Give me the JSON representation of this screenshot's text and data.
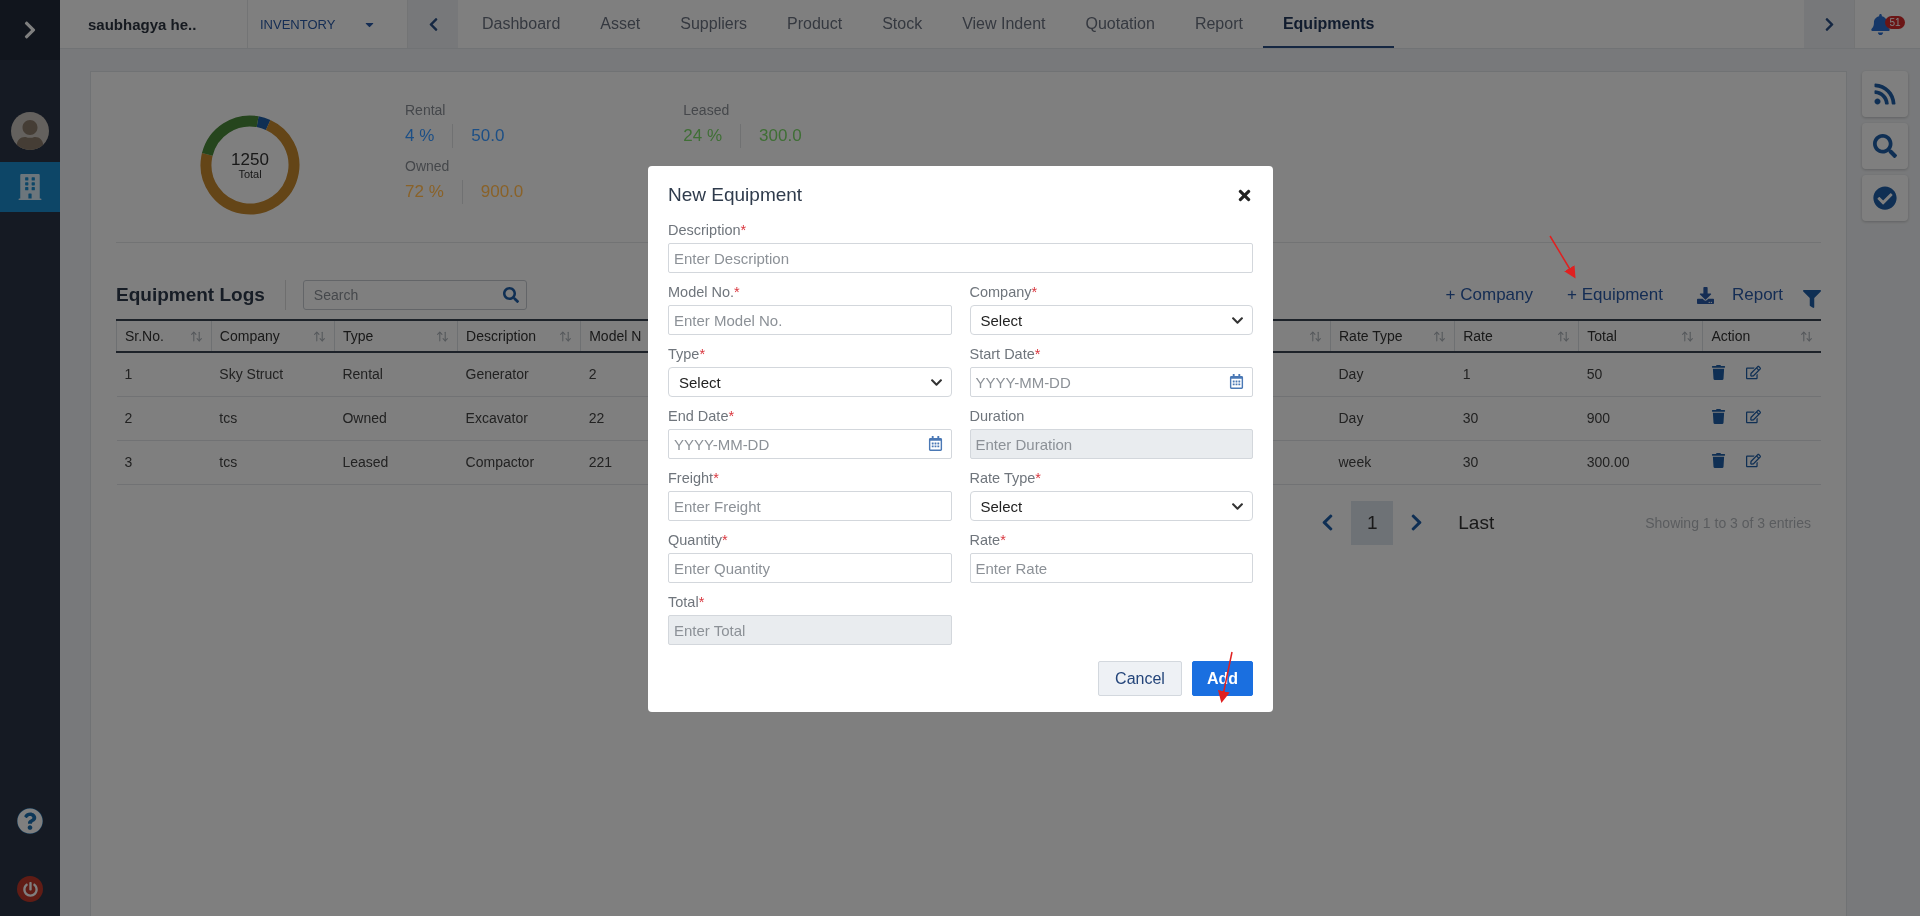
{
  "top_bar": {
    "brand": "saubhagya he..",
    "module": "INVENTORY",
    "notifications": "51",
    "tabs": [
      {
        "label": "Dashboard",
        "selected": false
      },
      {
        "label": "Asset",
        "selected": false
      },
      {
        "label": "Suppliers",
        "selected": false
      },
      {
        "label": "Product",
        "selected": false
      },
      {
        "label": "Stock",
        "selected": false
      },
      {
        "label": "View Indent",
        "selected": false
      },
      {
        "label": "Quotation",
        "selected": false
      },
      {
        "label": "Report",
        "selected": false
      },
      {
        "label": "Equipments",
        "selected": true
      }
    ]
  },
  "sidebar": {
    "items": [
      {
        "kind": "avatar",
        "selected": false
      },
      {
        "kind": "building",
        "selected": true
      }
    ]
  },
  "summary": {
    "total": "1250",
    "total_label": "Total",
    "columns": [
      [
        {
          "label": "Rental",
          "percent": "4 %",
          "amount": "50.0",
          "color": "#1c4f86"
        },
        {
          "label": "Owned",
          "percent": "72 %",
          "amount": "900.0",
          "color": "#8a6228"
        }
      ],
      [
        {
          "label": "Leased",
          "percent": "24 %",
          "amount": "300.0",
          "color": "#3f6f35"
        }
      ]
    ]
  },
  "logs": {
    "title": "Equipment Logs",
    "search": {
      "placeholder": "Search"
    },
    "actions": [
      {
        "kind": "link",
        "label": "+ Company"
      },
      {
        "kind": "link",
        "label": "+ Equipment"
      },
      {
        "kind": "download",
        "label": "Report"
      },
      {
        "kind": "filter"
      }
    ],
    "table": {
      "columns": [
        "Sr.No.",
        "Company",
        "Type",
        "Description",
        "Model N",
        "Rate Type",
        "Rate",
        "Total",
        "Action"
      ],
      "rows": [
        [
          "1",
          "Sky Struct",
          "Rental",
          "Generator",
          "2",
          "Day",
          "1",
          "50"
        ],
        [
          "2",
          "tcs",
          "Owned",
          "Excavator",
          "22",
          "Day",
          "30",
          "900"
        ],
        [
          "3",
          "tcs",
          "Leased",
          "Compactor",
          "221",
          "week",
          "30",
          "300.00"
        ]
      ]
    },
    "pagination": {
      "pages": [
        {
          "label": "1",
          "selected": true
        }
      ],
      "last": "Last",
      "info": "Showing 1 to 3 of 3 entries"
    }
  },
  "modal": {
    "title": "New Equipment",
    "wide_field": {
      "label": "Description",
      "required_mark": "*",
      "kind": "text",
      "placeholder": "Enter Description"
    },
    "fields": [
      {
        "label": "Model No.",
        "required_mark": "*",
        "kind": "text",
        "placeholder": "Enter Model No."
      },
      {
        "label": "Company",
        "required_mark": "*",
        "kind": "select",
        "value": "Select"
      },
      {
        "label": "Type",
        "required_mark": "*",
        "kind": "select",
        "value": "Select"
      },
      {
        "label": "Start Date",
        "required_mark": "*",
        "kind": "date",
        "placeholder": "YYYY-MM-DD"
      },
      {
        "label": "End Date",
        "required_mark": "*",
        "kind": "date",
        "placeholder": "YYYY-MM-DD"
      },
      {
        "label": "Duration",
        "kind": "readonly",
        "placeholder": "Enter Duration"
      },
      {
        "label": "Freight",
        "required_mark": "*",
        "kind": "text",
        "placeholder": "Enter Freight"
      },
      {
        "label": "Rate Type",
        "required_mark": "*",
        "kind": "select",
        "value": "Select"
      },
      {
        "label": "Quantity",
        "required_mark": "*",
        "kind": "text",
        "placeholder": "Enter Quantity"
      },
      {
        "label": "Rate",
        "required_mark": "*",
        "kind": "text",
        "placeholder": "Enter Rate"
      },
      {
        "label": "Total",
        "required_mark": "*",
        "kind": "readonly",
        "placeholder": "Enter Total"
      }
    ],
    "buttons": [
      {
        "label": "Cancel",
        "kind": "secondary"
      },
      {
        "label": "Add",
        "kind": "primary"
      }
    ]
  }
}
